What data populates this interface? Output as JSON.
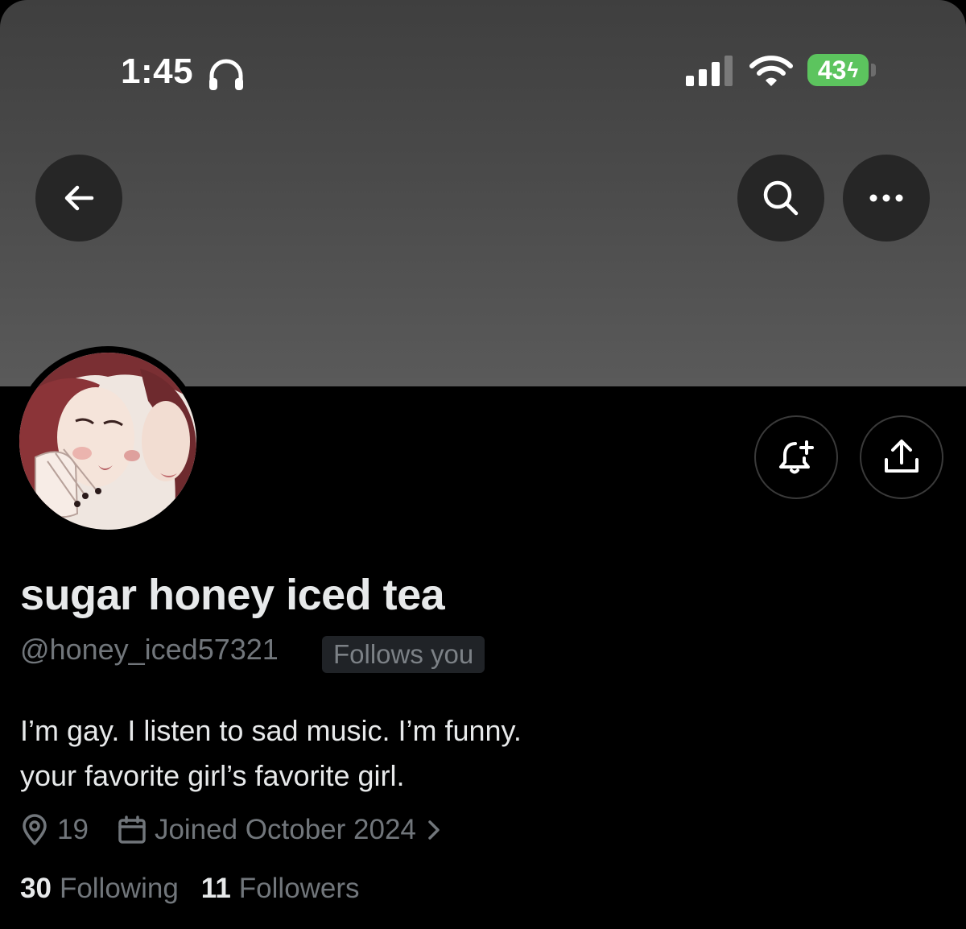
{
  "status_bar": {
    "time": "1:45",
    "battery_level": "43"
  },
  "nav": {
    "back_icon": "arrow-left-icon",
    "search_icon": "search-icon",
    "more_icon": "ellipsis-icon"
  },
  "actions": {
    "notify_icon": "bell-plus-icon",
    "share_icon": "share-upload-icon"
  },
  "profile": {
    "display_name": "sugar honey iced tea",
    "handle": "@honey_iced57321",
    "follows_you_label": "Follows you",
    "bio": "I’m gay. I listen to sad music. I’m funny.\nyour favorite girl’s favorite girl.",
    "location": "19",
    "joined": "Joined October 2024",
    "following_count": "30",
    "following_label": "Following",
    "followers_count": "11",
    "followers_label": "Followers"
  },
  "colors": {
    "background": "#000000",
    "primary_text": "#e7e9ea",
    "secondary_text": "#71767b",
    "battery_green": "#5cc45e"
  }
}
